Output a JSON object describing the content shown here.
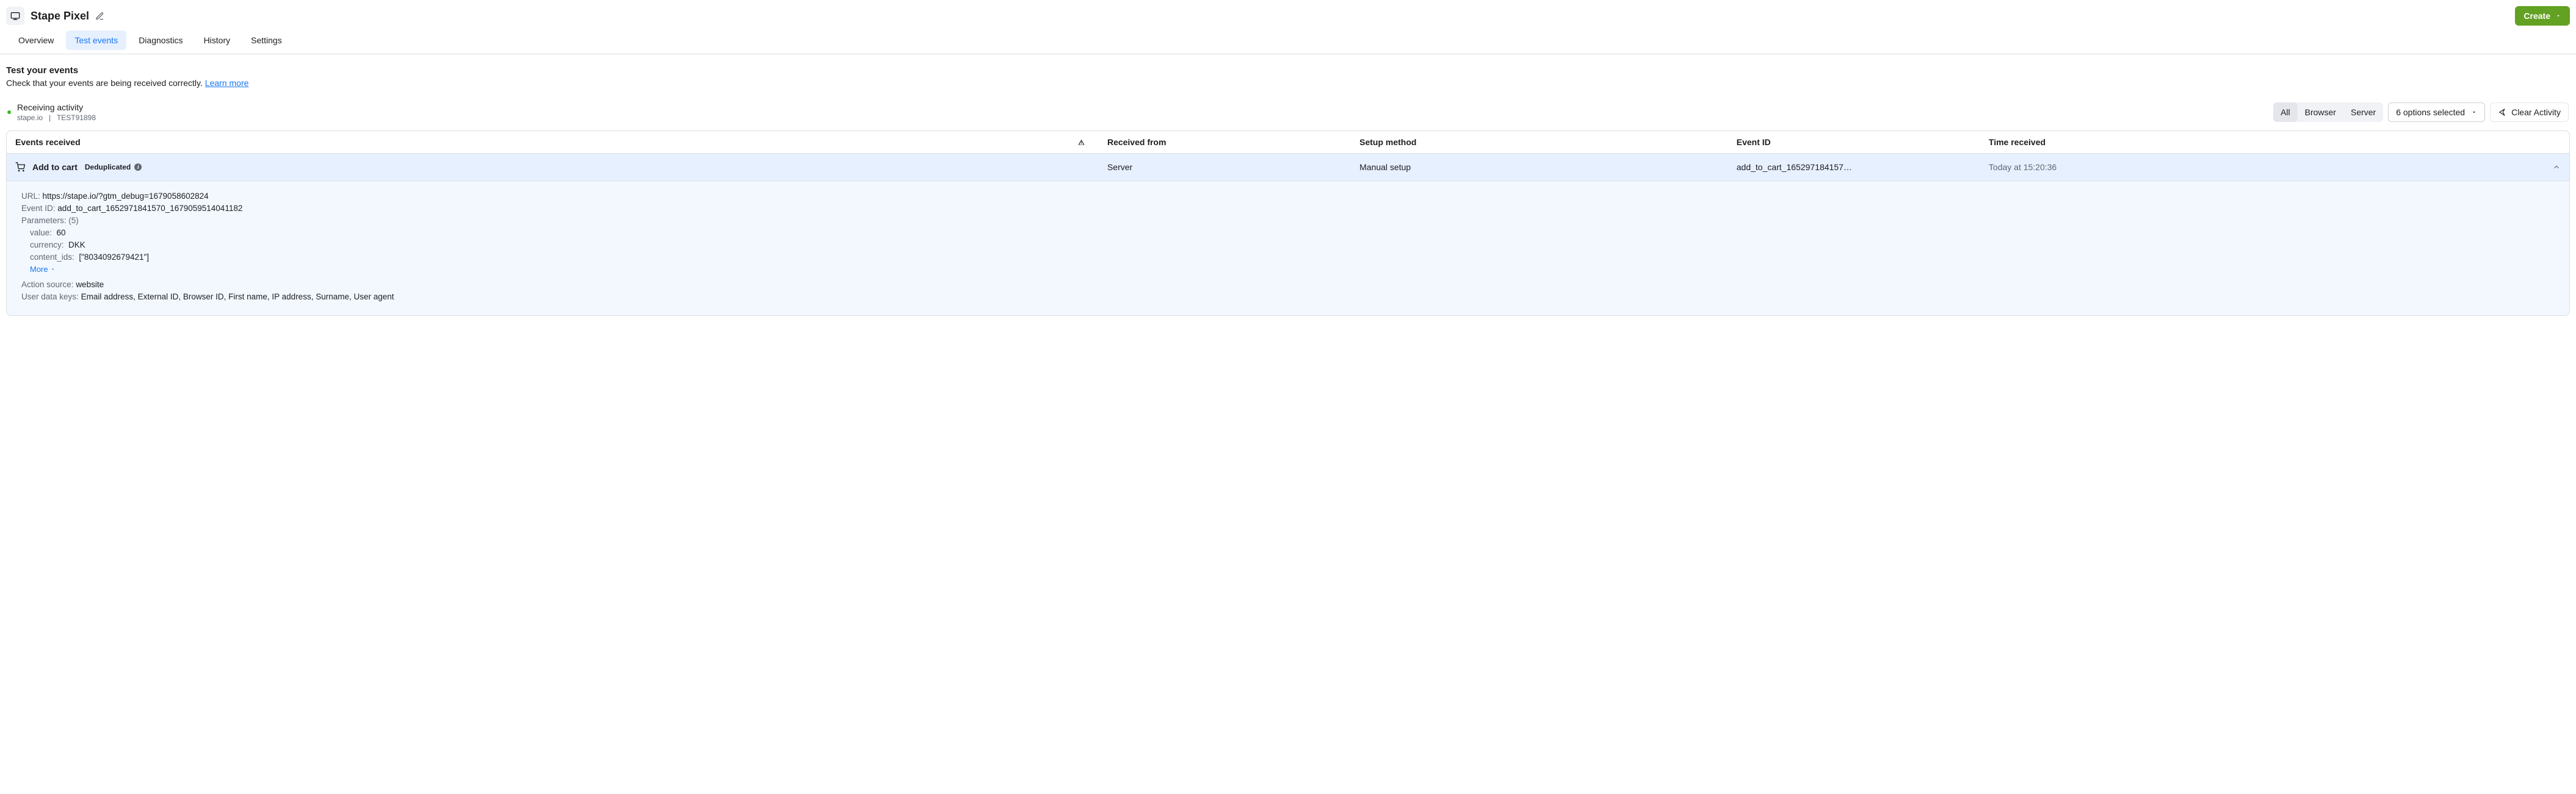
{
  "page_title": "Stape Pixel",
  "create_label": "Create",
  "tabs": [
    {
      "label": "Overview"
    },
    {
      "label": "Test events"
    },
    {
      "label": "Diagnostics"
    },
    {
      "label": "History"
    },
    {
      "label": "Settings"
    }
  ],
  "active_tab_index": 1,
  "section": {
    "title": "Test your events",
    "desc_prefix": "Check that your events are being received correctly. ",
    "learn_more": "Learn more"
  },
  "activity": {
    "title": "Receiving activity",
    "domain": "stape.io",
    "separator": "|",
    "test_id": "TEST91898"
  },
  "filters": {
    "seg_all": "All",
    "seg_browser": "Browser",
    "seg_server": "Server",
    "options": "6 options selected",
    "clear": "Clear Activity"
  },
  "columns": {
    "events": "Events received",
    "received_from": "Received from",
    "setup_method": "Setup method",
    "event_id": "Event ID",
    "time_received": "Time received"
  },
  "row": {
    "event_name": "Add to cart",
    "dedup_label": "Deduplicated",
    "received_from": "Server",
    "setup_method": "Manual setup",
    "event_id_truncated": "add_to_cart_165297184157…",
    "time_received": "Today at 15:20:36"
  },
  "details": {
    "url_label": "URL:",
    "url_value": "https://stape.io/?gtm_debug=1679058602824",
    "event_id_label": "Event ID:",
    "event_id_value": "add_to_cart_1652971841570_1679059514041182",
    "parameters_label": "Parameters:",
    "parameters_count": "(5)",
    "params": [
      {
        "label": "value:",
        "value": "60"
      },
      {
        "label": "currency:",
        "value": "DKK"
      },
      {
        "label": "content_ids:",
        "value": "[\"8034092679421\"]"
      }
    ],
    "more_label": "More",
    "action_source_label": "Action source:",
    "action_source_value": "website",
    "user_data_label": "User data keys:",
    "user_data_value": "Email address, External ID, Browser ID, First name, IP address, Surname, User agent"
  }
}
